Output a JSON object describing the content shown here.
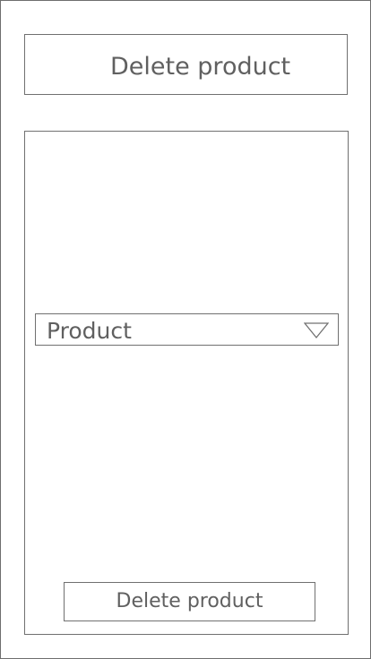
{
  "header": {
    "title": "Delete product"
  },
  "form": {
    "product_select": {
      "selected_value": "Product",
      "icon": "triangle-down-icon"
    },
    "delete_button_label": "Delete product"
  },
  "colors": {
    "border": "#707070",
    "text": "#606060",
    "background": "#ffffff"
  }
}
